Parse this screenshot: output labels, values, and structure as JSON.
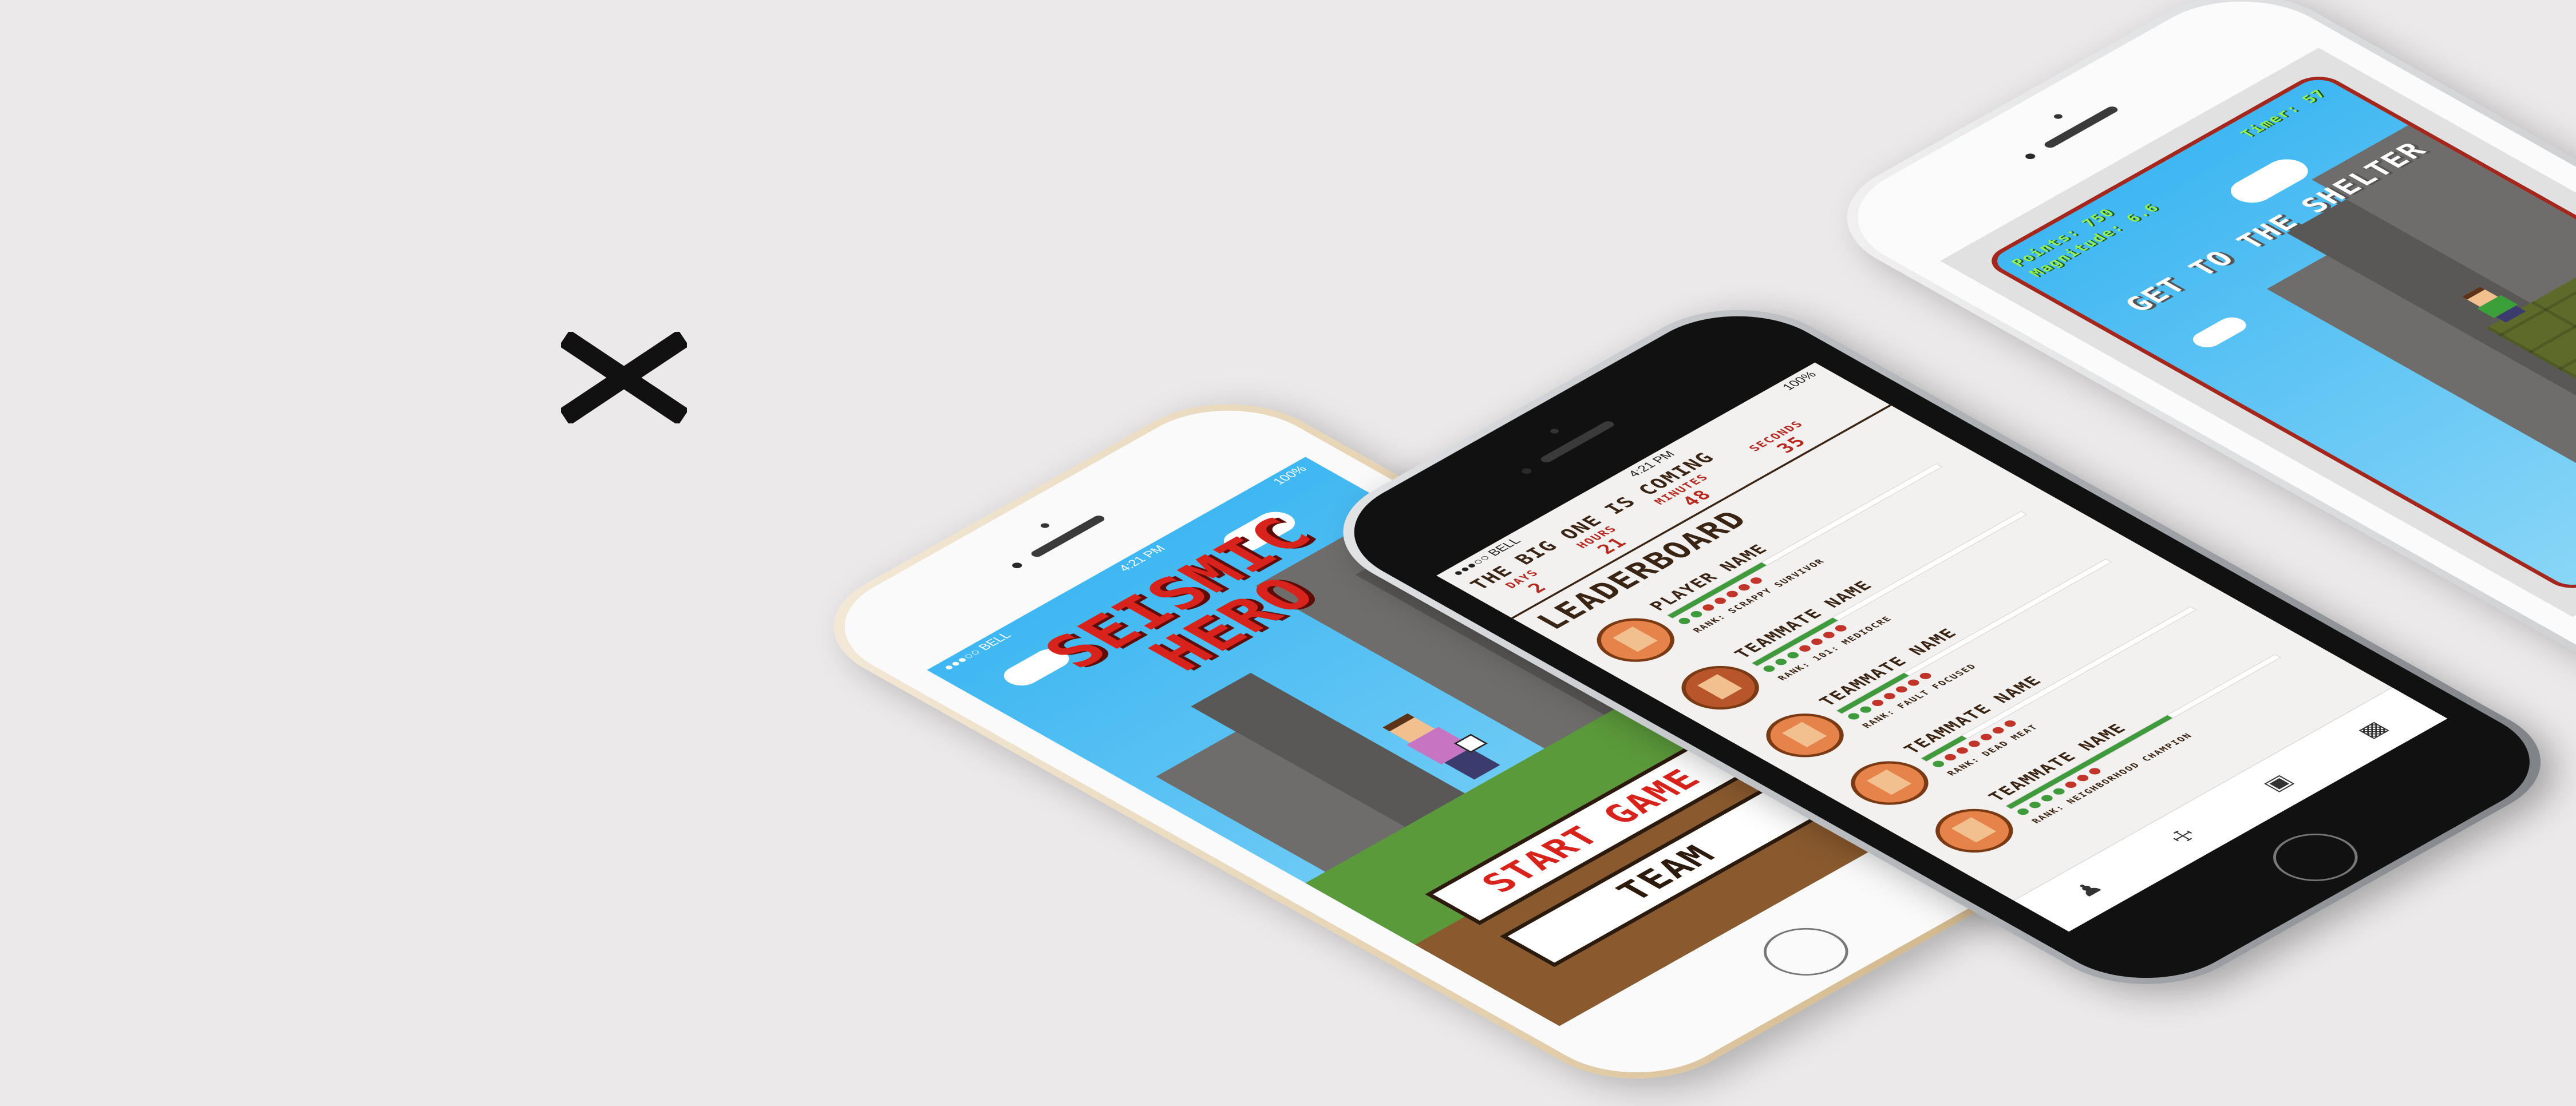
{
  "status_bar": {
    "carrier": "●●●○○ BELL",
    "time": "4:21 PM",
    "battery": "100%"
  },
  "title_screen": {
    "title_line1": "SEISMIC",
    "title_line2": "HERO",
    "start_button": "START GAME",
    "team_button": "TEAM"
  },
  "leaderboard_screen": {
    "countdown_title": "THE BIG ONE IS COMING",
    "countdown": [
      {
        "label": "DAYS",
        "value": "2"
      },
      {
        "label": "HOURS",
        "value": "21"
      },
      {
        "label": "MINUTES",
        "value": "48"
      },
      {
        "label": "SECONDS",
        "value": "35"
      }
    ],
    "heading": "LEADERBOARD",
    "rows": [
      {
        "name": "PLAYER NAME",
        "rank": "RANK: SCRAPPY SURVIVOR",
        "progress": 0.35,
        "dots_on": 2,
        "dots_total": 7
      },
      {
        "name": "TEAMMATE NAME",
        "rank": "RANK: 101: MEDIOCRE",
        "progress": 0.3,
        "dots_on": 3,
        "dots_total": 7
      },
      {
        "name": "TEAMMATE NAME",
        "rank": "RANK: FAULT FOCUSED",
        "progress": 0.25,
        "dots_on": 2,
        "dots_total": 7
      },
      {
        "name": "TEAMMATE NAME",
        "rank": "RANK: DEAD MEAT",
        "progress": 0.15,
        "dots_on": 1,
        "dots_total": 7
      },
      {
        "name": "TEAMMATE NAME",
        "rank": "RANK: NEIGHBORHOOD CHAMPION",
        "progress": 0.6,
        "dots_on": 4,
        "dots_total": 7
      }
    ],
    "nav": [
      "person-icon",
      "medkit-icon",
      "map-icon",
      "leaderboard-icon"
    ]
  },
  "game_screen": {
    "points_label": "Points:",
    "points_value": "750",
    "magnitude_label": "Magnitude:",
    "magnitude_value": "6.6",
    "timer_label": "Timer:",
    "timer_value": "57",
    "message": "GET TO THE SHELTER"
  },
  "colors": {
    "background": "#ebe9ea",
    "title_red": "#d8231c",
    "sky": "#3fb7f2",
    "grass": "#5b9a3b",
    "progress_green": "#3f9a3c",
    "dot_red": "#c0342a",
    "hud_green": "#8ff259"
  }
}
